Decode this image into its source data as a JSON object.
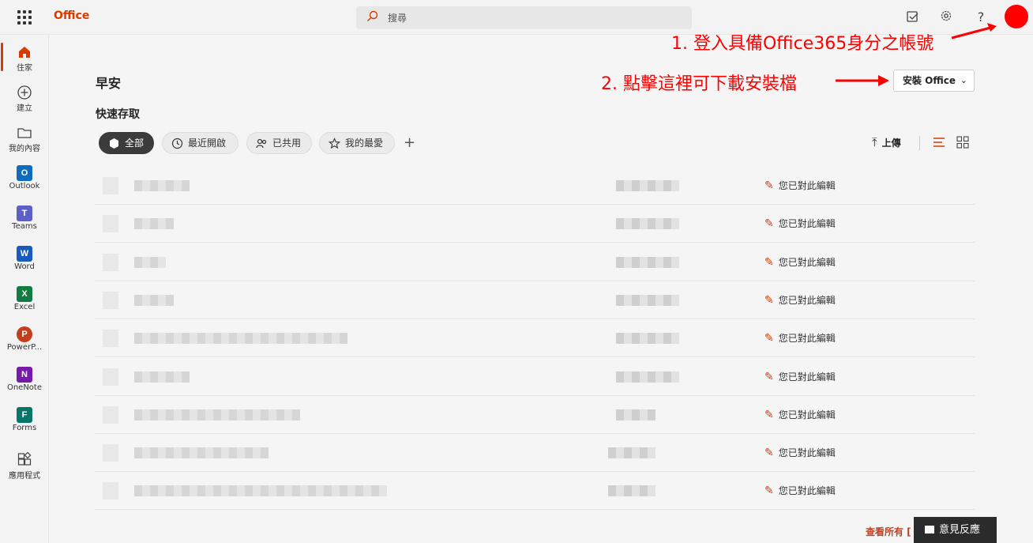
{
  "header": {
    "app_name": "Office",
    "search_placeholder": "搜尋",
    "help_label": "?"
  },
  "rail": {
    "items": [
      {
        "label": "住家"
      },
      {
        "label": "建立"
      },
      {
        "label": "我的內容"
      },
      {
        "label": "Outlook",
        "letter": "O"
      },
      {
        "label": "Teams",
        "letter": "T"
      },
      {
        "label": "Word",
        "letter": "W"
      },
      {
        "label": "Excel",
        "letter": "X"
      },
      {
        "label": "PowerP...",
        "letter": "P"
      },
      {
        "label": "OneNote",
        "letter": "N"
      },
      {
        "label": "Forms",
        "letter": "F"
      },
      {
        "label": "應用程式"
      }
    ]
  },
  "main": {
    "greeting": "早安",
    "quick_access": "快速存取",
    "filters": [
      "全部",
      "最近開啟",
      "已共用",
      "我的最愛"
    ],
    "add_label": "+",
    "install_label": "安裝 Office",
    "upload_label": "上傳",
    "edit_note": "您已對此編輯",
    "row_count": 9,
    "view_all": "查看所有 [",
    "feedback": "意見反應"
  },
  "annotations": {
    "step1": "1. 登入具備Office365身分之帳號",
    "step2": "2. 點擊這裡可下載安裝檔"
  },
  "colors": {
    "brand": "#d83b01",
    "annotation": "#ff0000",
    "outlook": "#0f6cbd",
    "teams": "#5b5fc7",
    "word": "#185abd",
    "excel": "#107c41",
    "powerpoint": "#c43e1c",
    "onenote": "#7719aa",
    "forms": "#077568"
  }
}
